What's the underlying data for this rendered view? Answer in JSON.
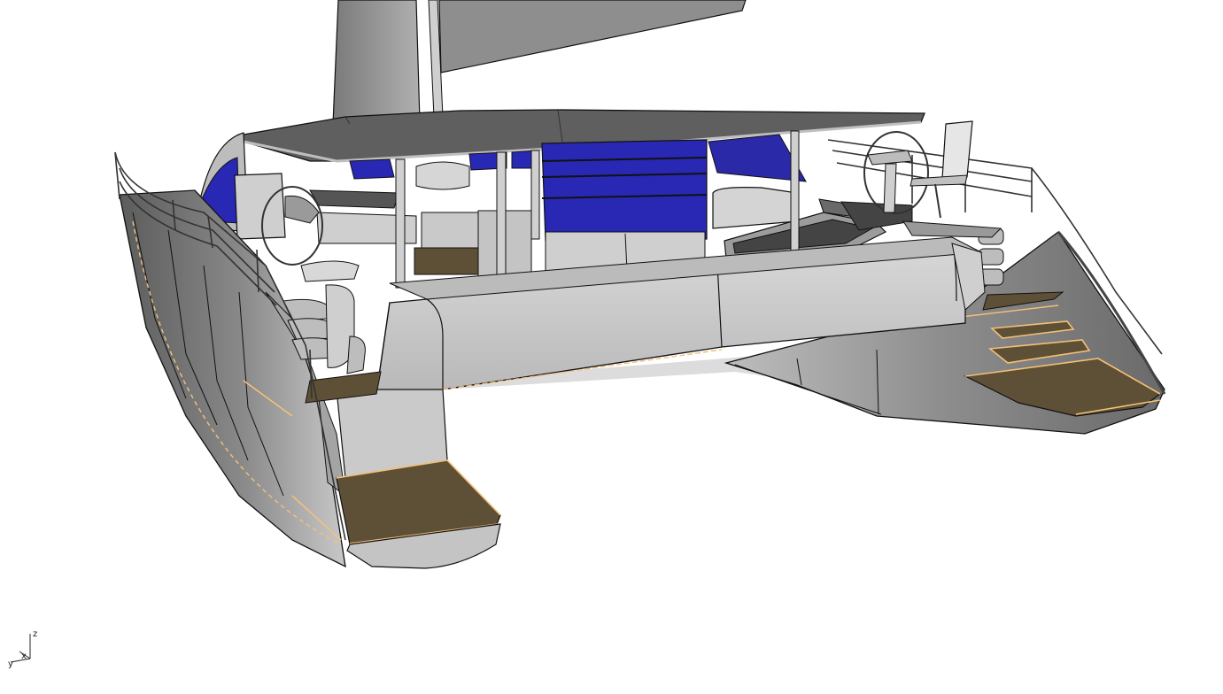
{
  "viewport": {
    "view_name": "Perspective",
    "background": "#ffffff"
  },
  "axes": {
    "x_label": "x",
    "y_label": "y",
    "z_label": "z"
  },
  "colors": {
    "hull_dark": "#6f6f6f",
    "hull_mid": "#9a9a9a",
    "hull_light": "#d2d2d2",
    "structure": "#c6c6c6",
    "roof": "#5f5f5f",
    "teak": "#5e5036",
    "glass": "#2828b4",
    "edge": "#111111",
    "highlight": "#f4c078"
  }
}
